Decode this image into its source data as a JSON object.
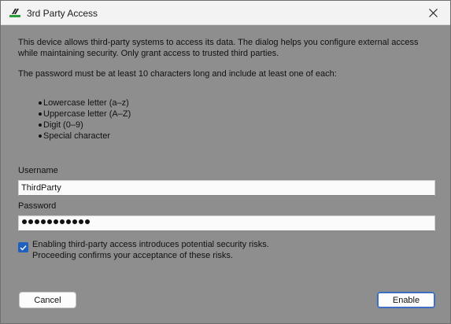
{
  "window": {
    "title": "3rd Party Access",
    "icon": "sennheiser-logo-icon",
    "close_icon": "close-icon"
  },
  "body": {
    "intro": "This device allows third-party systems to access its data. The dialog helps you configure external access while maintaining security. Only grant access to trusted third parties.",
    "requirement": "The password must be at least 10 characters long and include at least one of each:",
    "rules": [
      "Lowercase letter (a–z)",
      "Uppercase letter (A–Z)",
      "Digit (0–9)",
      "Special character"
    ]
  },
  "form": {
    "username_label": "Username",
    "username_value": "ThirdParty",
    "password_label": "Password",
    "password_length": 11,
    "consent_checked": true,
    "consent_line1": "Enabling third-party access introduces potential security risks.",
    "consent_line2": "Proceeding confirms your acceptance of these risks."
  },
  "buttons": {
    "cancel": "Cancel",
    "enable": "Enable"
  },
  "colors": {
    "dialog_background": "#8d8e8d",
    "titlebar": "#f3f3f3",
    "accent": "#1e5fbf"
  }
}
